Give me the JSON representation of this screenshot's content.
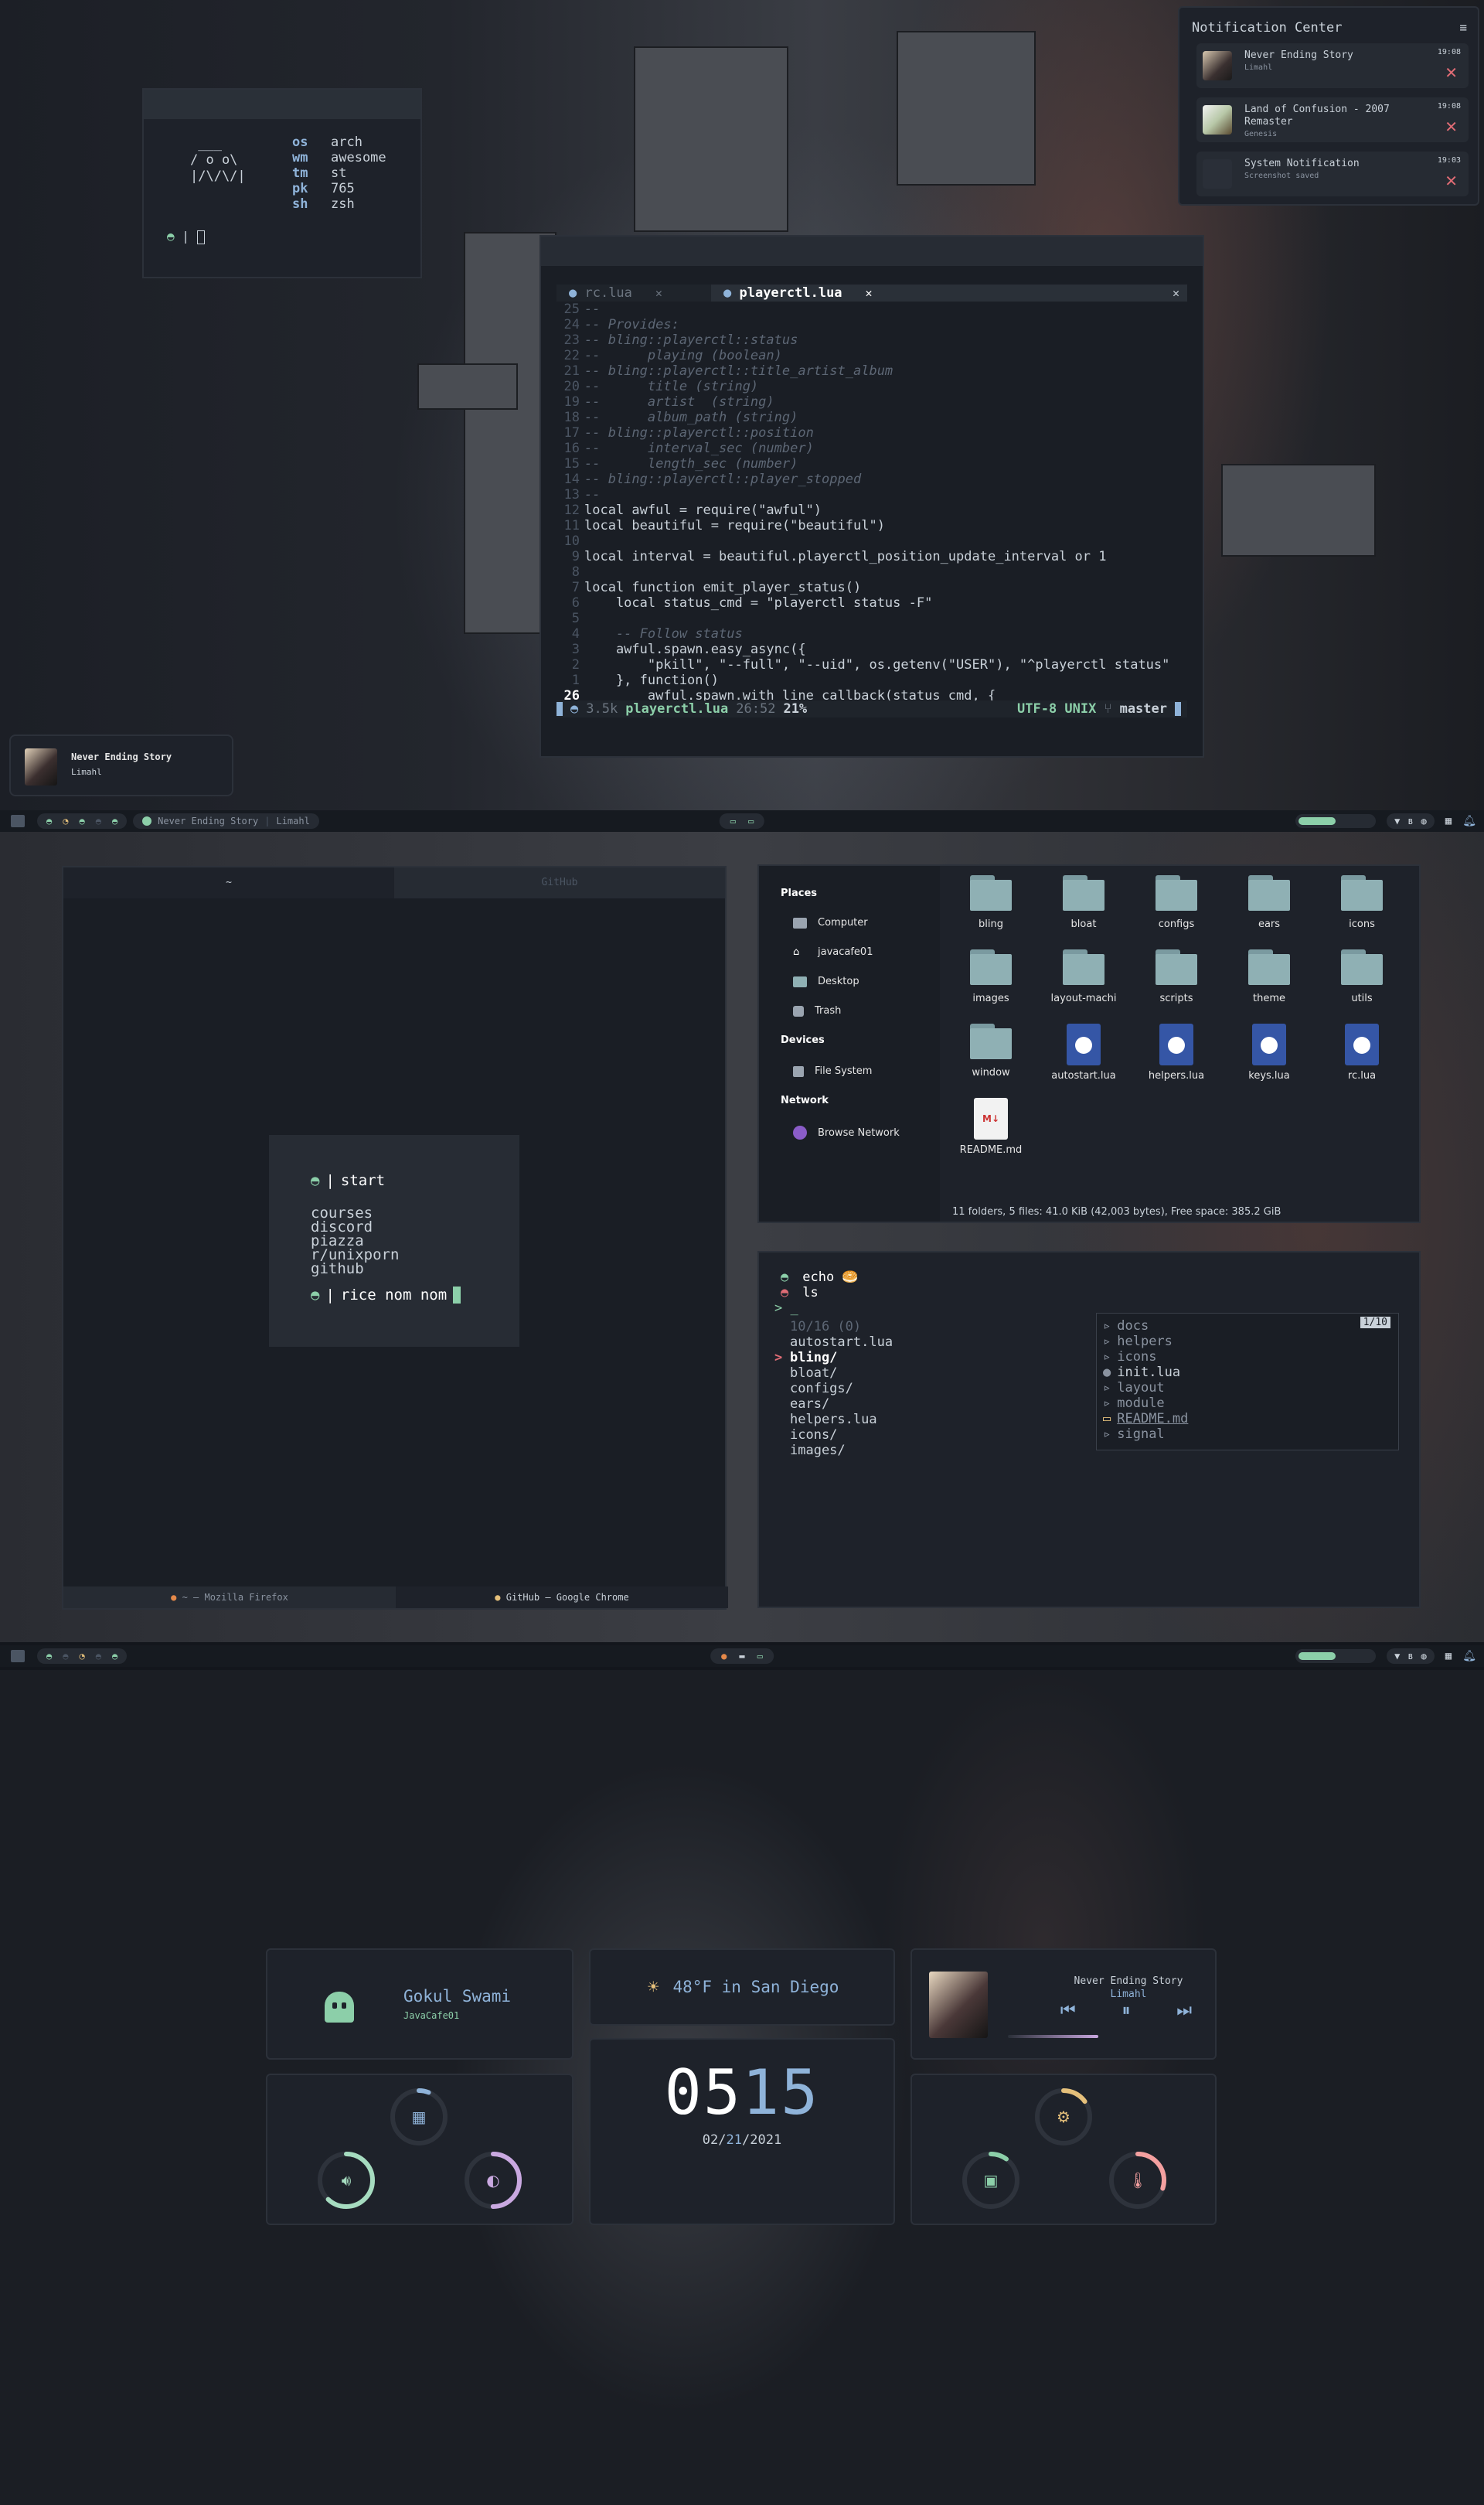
{
  "fetch": {
    "rows": [
      {
        "k": "os",
        "v": "arch"
      },
      {
        "k": "wm",
        "v": "awesome"
      },
      {
        "k": "tm",
        "v": "st"
      },
      {
        "k": "pk",
        "v": "765"
      },
      {
        "k": "sh",
        "v": "zsh"
      }
    ],
    "prompt_sep": "|"
  },
  "notifications": {
    "title": "Notification Center",
    "items": [
      {
        "title": "Never Ending Story",
        "subtitle": "Limahl",
        "time": "19:08"
      },
      {
        "title": "Land of Confusion - 2007 Remaster",
        "subtitle": "Genesis",
        "time": "19:08"
      },
      {
        "title": "System Notification",
        "subtitle": "Screenshot saved",
        "time": "19:03"
      }
    ]
  },
  "editor": {
    "tabs": [
      {
        "label": "rc.lua"
      },
      {
        "label": "playerctl.lua"
      }
    ],
    "lines": [
      {
        "n": "25",
        "t": "--",
        "c": "cm"
      },
      {
        "n": "24",
        "t": "-- Provides:",
        "c": "cm"
      },
      {
        "n": "23",
        "t": "-- bling::playerctl::status",
        "c": "cm"
      },
      {
        "n": "22",
        "t": "--      playing (boolean)",
        "c": "cm"
      },
      {
        "n": "21",
        "t": "-- bling::playerctl::title_artist_album",
        "c": "cm"
      },
      {
        "n": "20",
        "t": "--      title (string)",
        "c": "cm"
      },
      {
        "n": "19",
        "t": "--      artist  (string)",
        "c": "cm"
      },
      {
        "n": "18",
        "t": "--      album_path (string)",
        "c": "cm"
      },
      {
        "n": "17",
        "t": "-- bling::playerctl::position",
        "c": "cm"
      },
      {
        "n": "16",
        "t": "--      interval_sec (number)",
        "c": "cm"
      },
      {
        "n": "15",
        "t": "--      length_sec (number)",
        "c": "cm"
      },
      {
        "n": "14",
        "t": "-- bling::playerctl::player_stopped",
        "c": "cm"
      },
      {
        "n": "13",
        "t": "--",
        "c": "cm"
      },
      {
        "n": "12",
        "t": "local awful = require(\"awful\")",
        "c": "plain"
      },
      {
        "n": "11",
        "t": "local beautiful = require(\"beautiful\")",
        "c": "plain"
      },
      {
        "n": "10",
        "t": "",
        "c": "plain"
      },
      {
        "n": "9",
        "t": "local interval = beautiful.playerctl_position_update_interval or 1",
        "c": "plain"
      },
      {
        "n": "8",
        "t": "",
        "c": "plain"
      },
      {
        "n": "7",
        "t": "local function emit_player_status()",
        "c": "plain"
      },
      {
        "n": "6",
        "t": "    local status_cmd = \"playerctl status -F\"",
        "c": "plain"
      },
      {
        "n": "5",
        "t": "",
        "c": "plain"
      },
      {
        "n": "4",
        "t": "    -- Follow status",
        "c": "cm"
      },
      {
        "n": "3",
        "t": "    awful.spawn.easy_async({",
        "c": "plain"
      },
      {
        "n": "2",
        "t": "        \"pkill\", \"--full\", \"--uid\", os.getenv(\"USER\"), \"^playerctl status\"",
        "c": "plain"
      },
      {
        "n": "1",
        "t": "    }, function()",
        "c": "plain"
      },
      {
        "n": "26",
        "t": "        awful.spawn.with_line_callback(status_cmd, {",
        "c": "plain",
        "cur": true
      }
    ],
    "status": {
      "size": "3.5k",
      "file": "playerctl.lua",
      "pos": "26:52",
      "pct": "21%",
      "enc": "UTF-8 UNIX",
      "branch": "master"
    }
  },
  "mini_player": {
    "title": "Never Ending Story",
    "artist": "Limahl"
  },
  "bar1": {
    "np_title": "Never Ending Story",
    "np_artist": "Limahl"
  },
  "browser": {
    "tabs": [
      "~",
      "GitHub"
    ],
    "start_label": "start",
    "links": [
      "courses",
      "discord",
      "piazza",
      "r/unixporn",
      "github"
    ],
    "search_text": "rice nom nom",
    "footer": [
      "~ — Mozilla Firefox",
      "GitHub — Google Chrome"
    ]
  },
  "filemanager": {
    "places_header": "Places",
    "places": [
      "Computer",
      "javacafe01",
      "Desktop",
      "Trash"
    ],
    "devices_header": "Devices",
    "devices": [
      "File System"
    ],
    "network_header": "Network",
    "network": [
      "Browse Network"
    ],
    "files": [
      {
        "name": "bling",
        "type": "folder"
      },
      {
        "name": "bloat",
        "type": "folder"
      },
      {
        "name": "configs",
        "type": "folder"
      },
      {
        "name": "ears",
        "type": "folder"
      },
      {
        "name": "icons",
        "type": "folder"
      },
      {
        "name": "images",
        "type": "folder"
      },
      {
        "name": "layout-machi",
        "type": "folder"
      },
      {
        "name": "scripts",
        "type": "folder"
      },
      {
        "name": "theme",
        "type": "folder"
      },
      {
        "name": "utils",
        "type": "folder"
      },
      {
        "name": "window",
        "type": "folder"
      },
      {
        "name": "autostart.lua",
        "type": "lua"
      },
      {
        "name": "helpers.lua",
        "type": "lua"
      },
      {
        "name": "keys.lua",
        "type": "lua"
      },
      {
        "name": "rc.lua",
        "type": "lua"
      },
      {
        "name": "README.md",
        "type": "md"
      }
    ],
    "status": "11 folders, 5 files: 41.0 KiB (42,003 bytes), Free space: 385.2 GiB"
  },
  "terminal": {
    "cmd1": "echo 🥯",
    "cmd2": "ls",
    "prompt": "> _",
    "count": "10/16 (0)",
    "list": [
      "autostart.lua",
      "bling/",
      "bloat/",
      "configs/",
      "ears/",
      "helpers.lua",
      "icons/",
      "images/"
    ],
    "preview_page": "1/10",
    "preview": [
      "docs",
      "helpers",
      "icons",
      "init.lua",
      "layout",
      "module",
      "README.md",
      "signal"
    ]
  },
  "dashboard": {
    "user": "Gokul Swami",
    "host": "JavaCafe01",
    "weather": "48°F in San Diego",
    "hour": "05",
    "minute": "15",
    "date_m": "02",
    "date_d": "21",
    "date_y": "2021",
    "song": "Never Ending Story",
    "artist": "Limahl",
    "song_progress": 0.45,
    "rings": [
      {
        "name": "cpu",
        "value": 0.06,
        "color": "#8fb3d9"
      },
      {
        "name": "volume",
        "value": 0.62,
        "color": "#a6dcc0"
      },
      {
        "name": "brightness",
        "value": 0.5,
        "color": "#c9a8e0"
      },
      {
        "name": "temperature-cpu",
        "value": 0.15,
        "color": "#e5c07b"
      },
      {
        "name": "ram",
        "value": 0.1,
        "color": "#8ccfa9"
      },
      {
        "name": "temperature",
        "value": 0.3,
        "color": "#f4a0a0"
      }
    ]
  }
}
